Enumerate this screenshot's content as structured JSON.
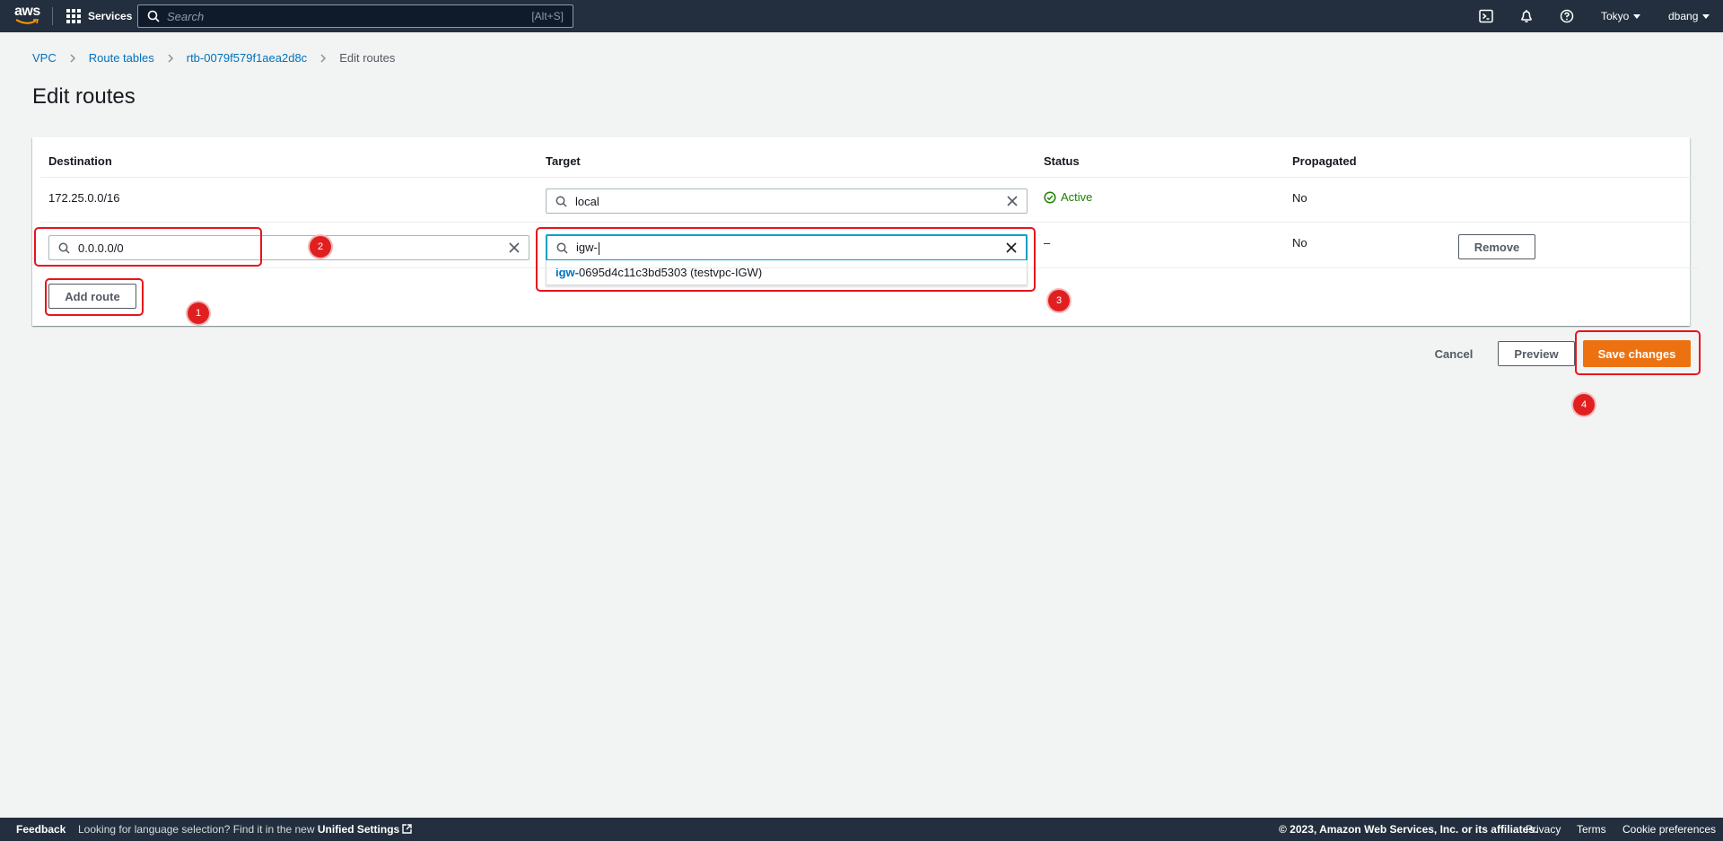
{
  "topnav": {
    "logo": "aws",
    "services_label": "Services",
    "search_placeholder": "Search",
    "search_shortcut": "[Alt+S]",
    "icons": [
      "cloudshell-icon",
      "bell-icon",
      "help-icon"
    ],
    "region": "Tokyo",
    "user": "dbang"
  },
  "breadcrumb": {
    "items": [
      "VPC",
      "Route tables",
      "rtb-0079f579f1aea2d8c"
    ],
    "current": "Edit routes"
  },
  "page": {
    "title": "Edit routes"
  },
  "routes": {
    "headers": {
      "destination": "Destination",
      "target": "Target",
      "status": "Status",
      "propagated": "Propagated"
    },
    "rows": [
      {
        "destination": "172.25.0.0/16",
        "target": "local",
        "status": "Active",
        "propagated": "No"
      },
      {
        "destination": "0.0.0.0/0",
        "target": "igw-",
        "status": "–",
        "propagated": "No",
        "remove_label": "Remove"
      }
    ],
    "suggestion": {
      "match": "igw-",
      "rest": "0695d4c11c3bd5303 (testvpc-IGW)"
    },
    "add_route_label": "Add route"
  },
  "actions": {
    "cancel": "Cancel",
    "preview": "Preview",
    "save": "Save changes"
  },
  "annotations": [
    "1",
    "2",
    "3",
    "4"
  ],
  "footer": {
    "feedback": "Feedback",
    "lang_text": "Looking for language selection? Find it in the new",
    "lang_link": "Unified Settings",
    "copyright": "© 2023, Amazon Web Services, Inc. or its affiliates.",
    "links": [
      "Privacy",
      "Terms",
      "Cookie preferences"
    ]
  },
  "colors": {
    "nav_bg": "#232f3e",
    "link": "#0073bb",
    "primary": "#ec7211",
    "success": "#1d8102",
    "annotation": "#e8141b",
    "focus": "#00a1c9"
  }
}
